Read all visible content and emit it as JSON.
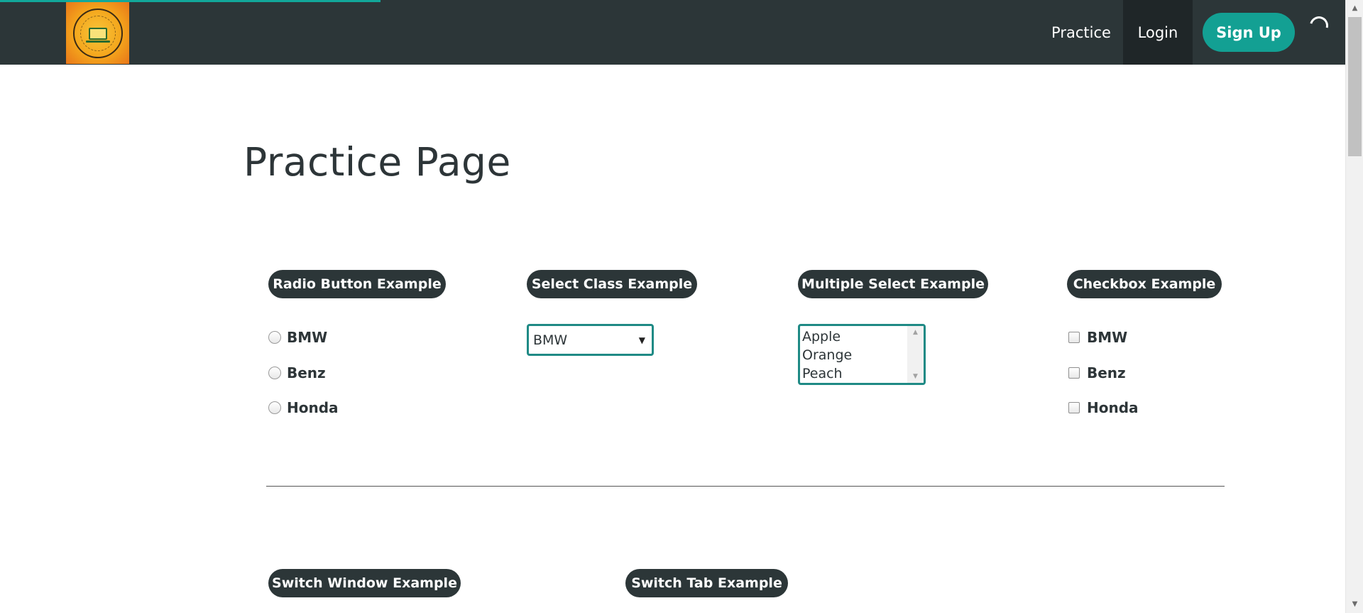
{
  "nav": {
    "links": [
      "Practice",
      "Login"
    ],
    "signup": "Sign Up"
  },
  "page": {
    "title": "Practice Page"
  },
  "radio_section": {
    "legend": "Radio Button Example",
    "options": [
      "BMW",
      "Benz",
      "Honda"
    ]
  },
  "select_section": {
    "legend": "Select Class Example",
    "selected": "BMW"
  },
  "multi_section": {
    "legend": "Multiple Select Example",
    "options": [
      "Apple",
      "Orange",
      "Peach"
    ]
  },
  "checkbox_section": {
    "legend": "Checkbox Example",
    "options": [
      "BMW",
      "Benz",
      "Honda"
    ]
  },
  "switch_window": {
    "legend": "Switch Window Example"
  },
  "switch_tab": {
    "legend": "Switch Tab Example"
  },
  "colors": {
    "navbar": "#2c3638",
    "accent": "#13a093",
    "select_border": "#1f8a85"
  }
}
